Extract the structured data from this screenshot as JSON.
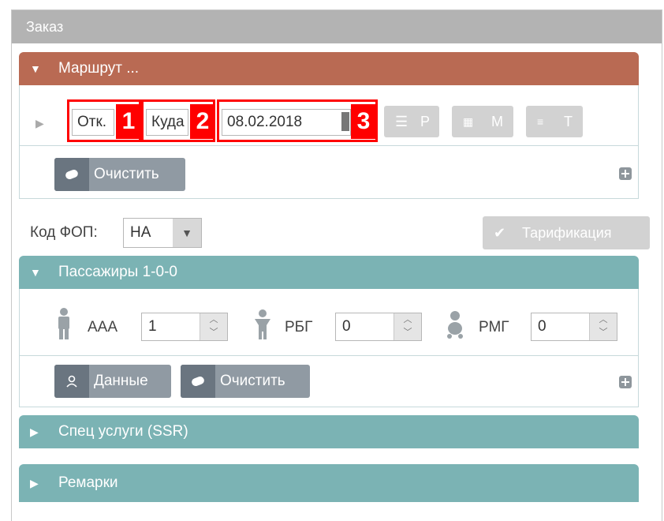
{
  "panel": {
    "title": "Заказ"
  },
  "route": {
    "title": "Маршрут ...",
    "from_value": "Отк.",
    "to_value": "Куда",
    "date_value": "08.02.2018",
    "badges": [
      "1",
      "2",
      "3"
    ],
    "btn_r": "Р",
    "btn_m": "М",
    "btn_t": "Т",
    "clear_label": "Очистить"
  },
  "fop": {
    "label": "Код ФОП:",
    "value": "НА",
    "tariff_label": "Тарификация"
  },
  "passengers": {
    "title": "Пассажиры 1-0-0",
    "adult_label": "ААА",
    "adult_value": "1",
    "child_label": "РБГ",
    "child_value": "0",
    "infant_label": "РМГ",
    "infant_value": "0",
    "data_label": "Данные",
    "clear_label": "Очистить"
  },
  "ssr": {
    "title": "Спец услуги (SSR)"
  },
  "remarks": {
    "title": "Ремарки"
  },
  "colors": {
    "route_header": "#b96a53",
    "section_header": "#7bb3b4",
    "highlight": "#ff0000"
  }
}
